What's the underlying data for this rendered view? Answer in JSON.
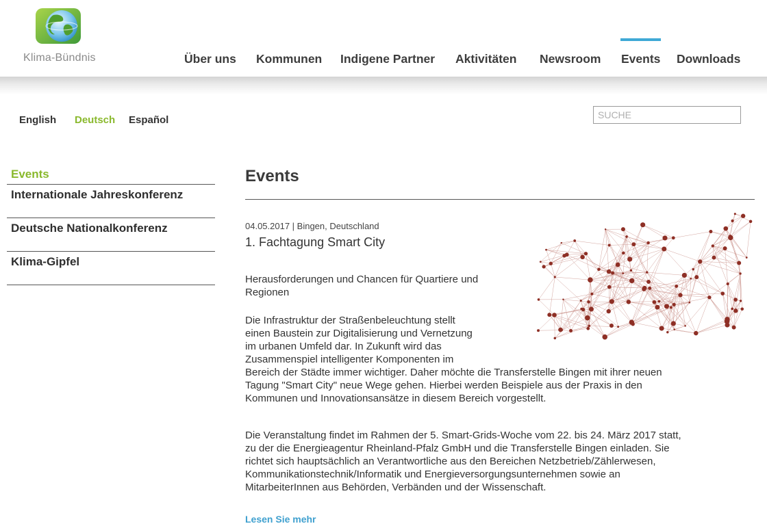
{
  "header": {
    "brand": "Klima-Bündnis",
    "nav": [
      {
        "label": "Über uns"
      },
      {
        "label": "Kommunen"
      },
      {
        "label": "Indigene Partner"
      },
      {
        "label": "Aktivitäten"
      },
      {
        "label": "Newsroom"
      },
      {
        "label": "Events",
        "active": true
      },
      {
        "label": "Downloads"
      }
    ],
    "accent_color": "#3fa9d6"
  },
  "languages": [
    {
      "label": "English"
    },
    {
      "label": "Deutsch",
      "active": true
    },
    {
      "label": "Español"
    }
  ],
  "search": {
    "placeholder": "SUCHE",
    "value": ""
  },
  "sidebar": {
    "items": [
      {
        "label": "Events",
        "active": true
      },
      {
        "label": "Internationale Jahreskonferenz"
      },
      {
        "label": "Deutsche Nationalkonferenz"
      },
      {
        "label": "Klima-Gipfel"
      }
    ],
    "active_color": "#8ab92d"
  },
  "main": {
    "title": "Events",
    "event": {
      "meta": "04.05.2017 | Bingen, Deutschland",
      "title": "1. Fachtagung Smart City",
      "subtitle_lines": [
        "Herausforderungen und Chancen für Quartiere und",
        "Regionen"
      ],
      "paragraph1_lines": [
        "Die Infrastruktur der Straßenbeleuchtung stellt",
        "einen Baustein zur Digitalisierung und Vernetzung",
        "im urbanen Umfeld dar. In Zukunft wird das",
        "Zusammenspiel intelligenter Komponenten im",
        "Bereich der Städte immer wichtiger. Daher möchte die Transferstelle Bingen mit ihrer neuen",
        "Tagung \"Smart City\" neue Wege gehen. Hierbei werden Beispiele aus der Praxis in den",
        "Kommunen und Innovationsansätze in diesem Bereich vorgestellt."
      ],
      "paragraph2_lines": [
        "Die Veranstaltung findet im Rahmen der 5. Smart-Grids-Woche vom 22. bis 24. März 2017 statt,",
        "zu der die Energieagentur Rheinland-Pfalz GmbH und die Transferstelle Bingen einladen. Sie",
        "richtet sich hauptsächlich an Verantwortliche aus den Bereichen Netzbetrieb/Zählerwesen,",
        "Kommunikationstechnik/Informatik und Energieversorgungsunternehmen sowie an",
        "MitarbeiterInnen aus Behörden, Verbänden und der Wissenschaft."
      ],
      "read_more": "Lesen Sie mehr",
      "image_icon": "network-graph-image",
      "link_color": "#3fa0cf"
    }
  }
}
